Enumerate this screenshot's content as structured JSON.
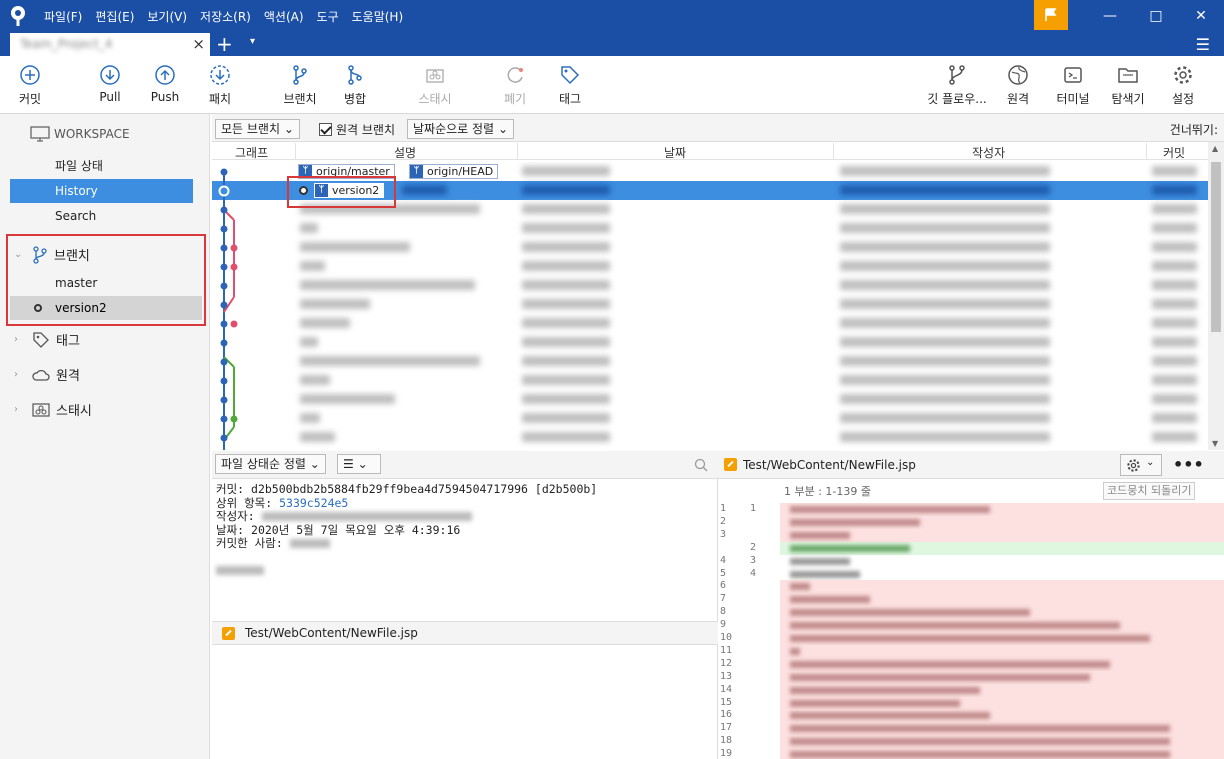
{
  "titlebar": {
    "menu": [
      "파일(F)",
      "편집(E)",
      "보기(V)",
      "저장소(R)",
      "액션(A)",
      "도구",
      "도움말(H)"
    ],
    "accent": "#1b4fa5"
  },
  "tab": {
    "name": "Team_Project_4",
    "close": "×",
    "plus": "+",
    "dropdown": "▾"
  },
  "toolbar": {
    "commit": "커밋",
    "pull": "Pull",
    "push": "Push",
    "fetch": "패치",
    "branch": "브랜치",
    "merge": "병합",
    "stash": "스태시",
    "discard": "폐기",
    "tag": "태그",
    "gitflow": "깃 플로우...",
    "remote": "원격",
    "terminal": "터미널",
    "explorer": "탐색기",
    "settings": "설정"
  },
  "sidebar": {
    "workspace": "WORKSPACE",
    "items": [
      "파일 상태",
      "History",
      "Search"
    ],
    "branches_label": "브랜치",
    "branches": [
      "master",
      "version2"
    ],
    "tags": "태그",
    "remotes": "원격",
    "stashes": "스태시"
  },
  "filter": {
    "all_branches": "모든 브랜치",
    "remote_branches": "원격 브랜치",
    "sort": "날짜순으로 정렬",
    "skip": "건너뛰기:"
  },
  "columns": {
    "graph": "그래프",
    "desc": "설명",
    "date": "날짜",
    "author": "작성자",
    "commit": "커밋"
  },
  "refs": {
    "origin_master": "origin/master",
    "origin_head": "origin/HEAD",
    "version2": "version2"
  },
  "detail": {
    "sort": "파일 상태순 정렬",
    "commit_label": "커밋:",
    "commit_value": "d2b500bdb2b5884fb29ff9bea4d7594504717996 [d2b500b]",
    "parent_label": "상위 항목:",
    "parent_value": "5339c524e5",
    "author_label": "작성자:",
    "date_label": "날짜:",
    "date_value": "2020년 5월 7일 목요일 오후 4:39:16",
    "committer_label": "커밋한 사람:",
    "file": "Test/WebContent/NewFile.jsp"
  },
  "diff": {
    "file": "Test/WebContent/NewFile.jsp",
    "hunk": "1 부분 : 1-139 줄",
    "revert": "코드뭉치 되돌리기"
  }
}
